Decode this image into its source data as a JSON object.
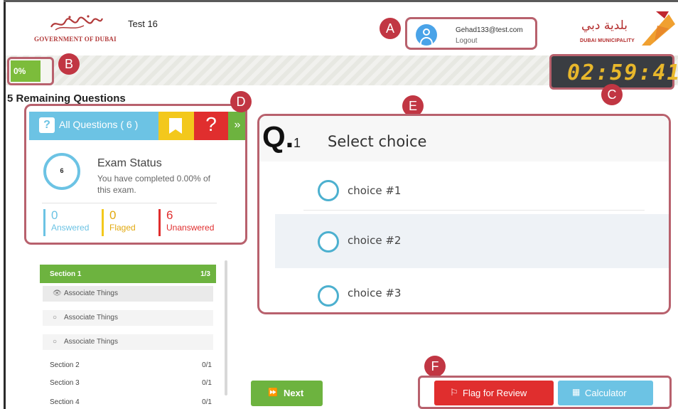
{
  "header": {
    "gov_logo_text": "GOVERNMENT OF DUBAI",
    "exam_title": "Test 16",
    "user_email": "Gehad133@test.com",
    "logout_label": "Logout",
    "dm_logo_arabic": "بلدية دبي",
    "dm_logo_text": "DUBAI MUNICIPALITY"
  },
  "markers": {
    "a": "A",
    "b": "B",
    "c": "C",
    "d": "D",
    "e": "E",
    "f": "F"
  },
  "progress": {
    "label": "0%",
    "value": 0
  },
  "timer": {
    "display": "02:59:41"
  },
  "remaining_label": "5 Remaining Questions",
  "question_panel": {
    "tabs": {
      "all_label": "All Questions ( 6 )",
      "all_icon": "?",
      "flagged_icon": "bookmark-icon",
      "unanswered_icon": "?",
      "expand_icon": "»"
    },
    "exam_status": {
      "ring_value": "6",
      "title": "Exam Status",
      "desc": "You have completed 0.00% of this exam."
    },
    "stats": {
      "answered_num": "0",
      "answered_label": "Answered",
      "flagged_num": "0",
      "flagged_label": "Flaged",
      "unanswered_num": "6",
      "unanswered_label": "Unanswered"
    }
  },
  "sections": {
    "current": {
      "title": "Section 1",
      "count": "1/3"
    },
    "items": [
      {
        "label": "Associate Things",
        "icon": "👁"
      },
      {
        "label": "Associate Things",
        "icon": "○"
      },
      {
        "label": "Associate Things",
        "icon": "○"
      }
    ],
    "others": [
      {
        "title": "Section 2",
        "count": "0/1"
      },
      {
        "title": "Section 3",
        "count": "0/1"
      },
      {
        "title": "Section 4",
        "count": "0/1"
      }
    ]
  },
  "question": {
    "prefix": "Q.",
    "number": "1",
    "text": "Select choice",
    "choices": [
      "choice #1",
      "choice #2",
      "choice #3"
    ]
  },
  "buttons": {
    "next_icon": "⏩",
    "next_label": "Next",
    "flag_icon": "⚐",
    "flag_label": "Flag for Review",
    "calc_icon": "▦",
    "calc_label": "Calculator"
  },
  "colors": {
    "accent_green": "#6db33f",
    "accent_blue": "#6cc3e4",
    "accent_red": "#e02e2e",
    "accent_yellow": "#f3c81c",
    "annotation": "#c13643"
  }
}
